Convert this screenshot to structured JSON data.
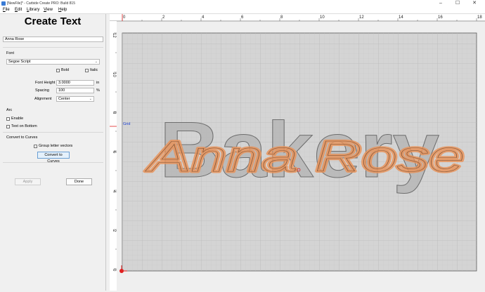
{
  "window": {
    "title": "[NewFile]* - Carbide Create PRO: Build 815"
  },
  "window_controls": {
    "minimize": "–",
    "maximize": "☐",
    "close": "✕"
  },
  "menu": {
    "items": [
      "File",
      "Edit",
      "Library",
      "View",
      "Help"
    ]
  },
  "panel": {
    "title": "Create Text",
    "text_value": "Anna Rose",
    "font_section_label": "Font",
    "font_value": "Segoe Script",
    "bold_label": "Bold",
    "italic_label": "Italic",
    "font_height_label": "Font Height",
    "font_height_value": "3.0000",
    "font_height_unit": "in",
    "spacing_label": "Spacing",
    "spacing_value": "100",
    "spacing_unit": "%",
    "alignment_label": "Alignment",
    "alignment_value": "Center",
    "arc_section_label": "Arc",
    "enable_label": "Enable",
    "text_on_bottom_label": "Text on Bottom",
    "convert_section_label": "Convert to Curves",
    "group_vectors_label": "Group letter vectors",
    "convert_button": "Convert to Curves",
    "apply_button": "Apply",
    "done_button": "Done"
  },
  "rulers": {
    "top_labels": [
      "0",
      "2",
      "4",
      "6",
      "8",
      "10",
      "12",
      "14",
      "16",
      "18"
    ],
    "left_labels": [
      "12",
      "10",
      "8",
      "6",
      "4",
      "2",
      "0"
    ]
  },
  "canvas": {
    "grid_label": "Grid",
    "outline_text": "Bakery",
    "script_text": "Anna Rose",
    "colors": {
      "stock": "#d4d4d4",
      "grid": "#bdbdbd",
      "script_stroke": "#e8935a",
      "origin": "#e02020",
      "grid_label": "#1a3fcf"
    }
  }
}
